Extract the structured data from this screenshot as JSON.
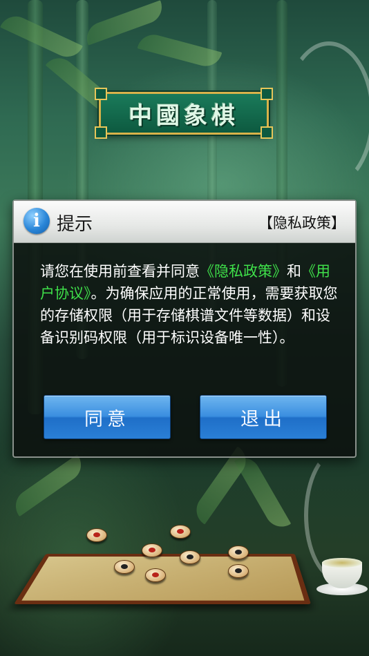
{
  "app": {
    "logo_text": "中國象棋"
  },
  "dialog": {
    "title": "提示",
    "header_link": "【隐私政策】",
    "body_parts": [
      {
        "text": "请您在使用前查看并同意",
        "highlight": false
      },
      {
        "text": "《隐私政策》",
        "highlight": true
      },
      {
        "text": "和",
        "highlight": false
      },
      {
        "text": "《用户协议》",
        "highlight": true
      },
      {
        "text": "。为确保应用的正常使用，需要获取您的存储权限（用于存储棋谱文件等数据）和设备识别码权限（用于标识设备唯一性）。",
        "highlight": false
      }
    ],
    "agree_label": "同意",
    "exit_label": "退出"
  },
  "colors": {
    "highlight": "#3fe04a",
    "button_blue": "#2a7fd6",
    "dialog_bg": "#0c100e"
  },
  "icons": {
    "info": "info-icon"
  }
}
